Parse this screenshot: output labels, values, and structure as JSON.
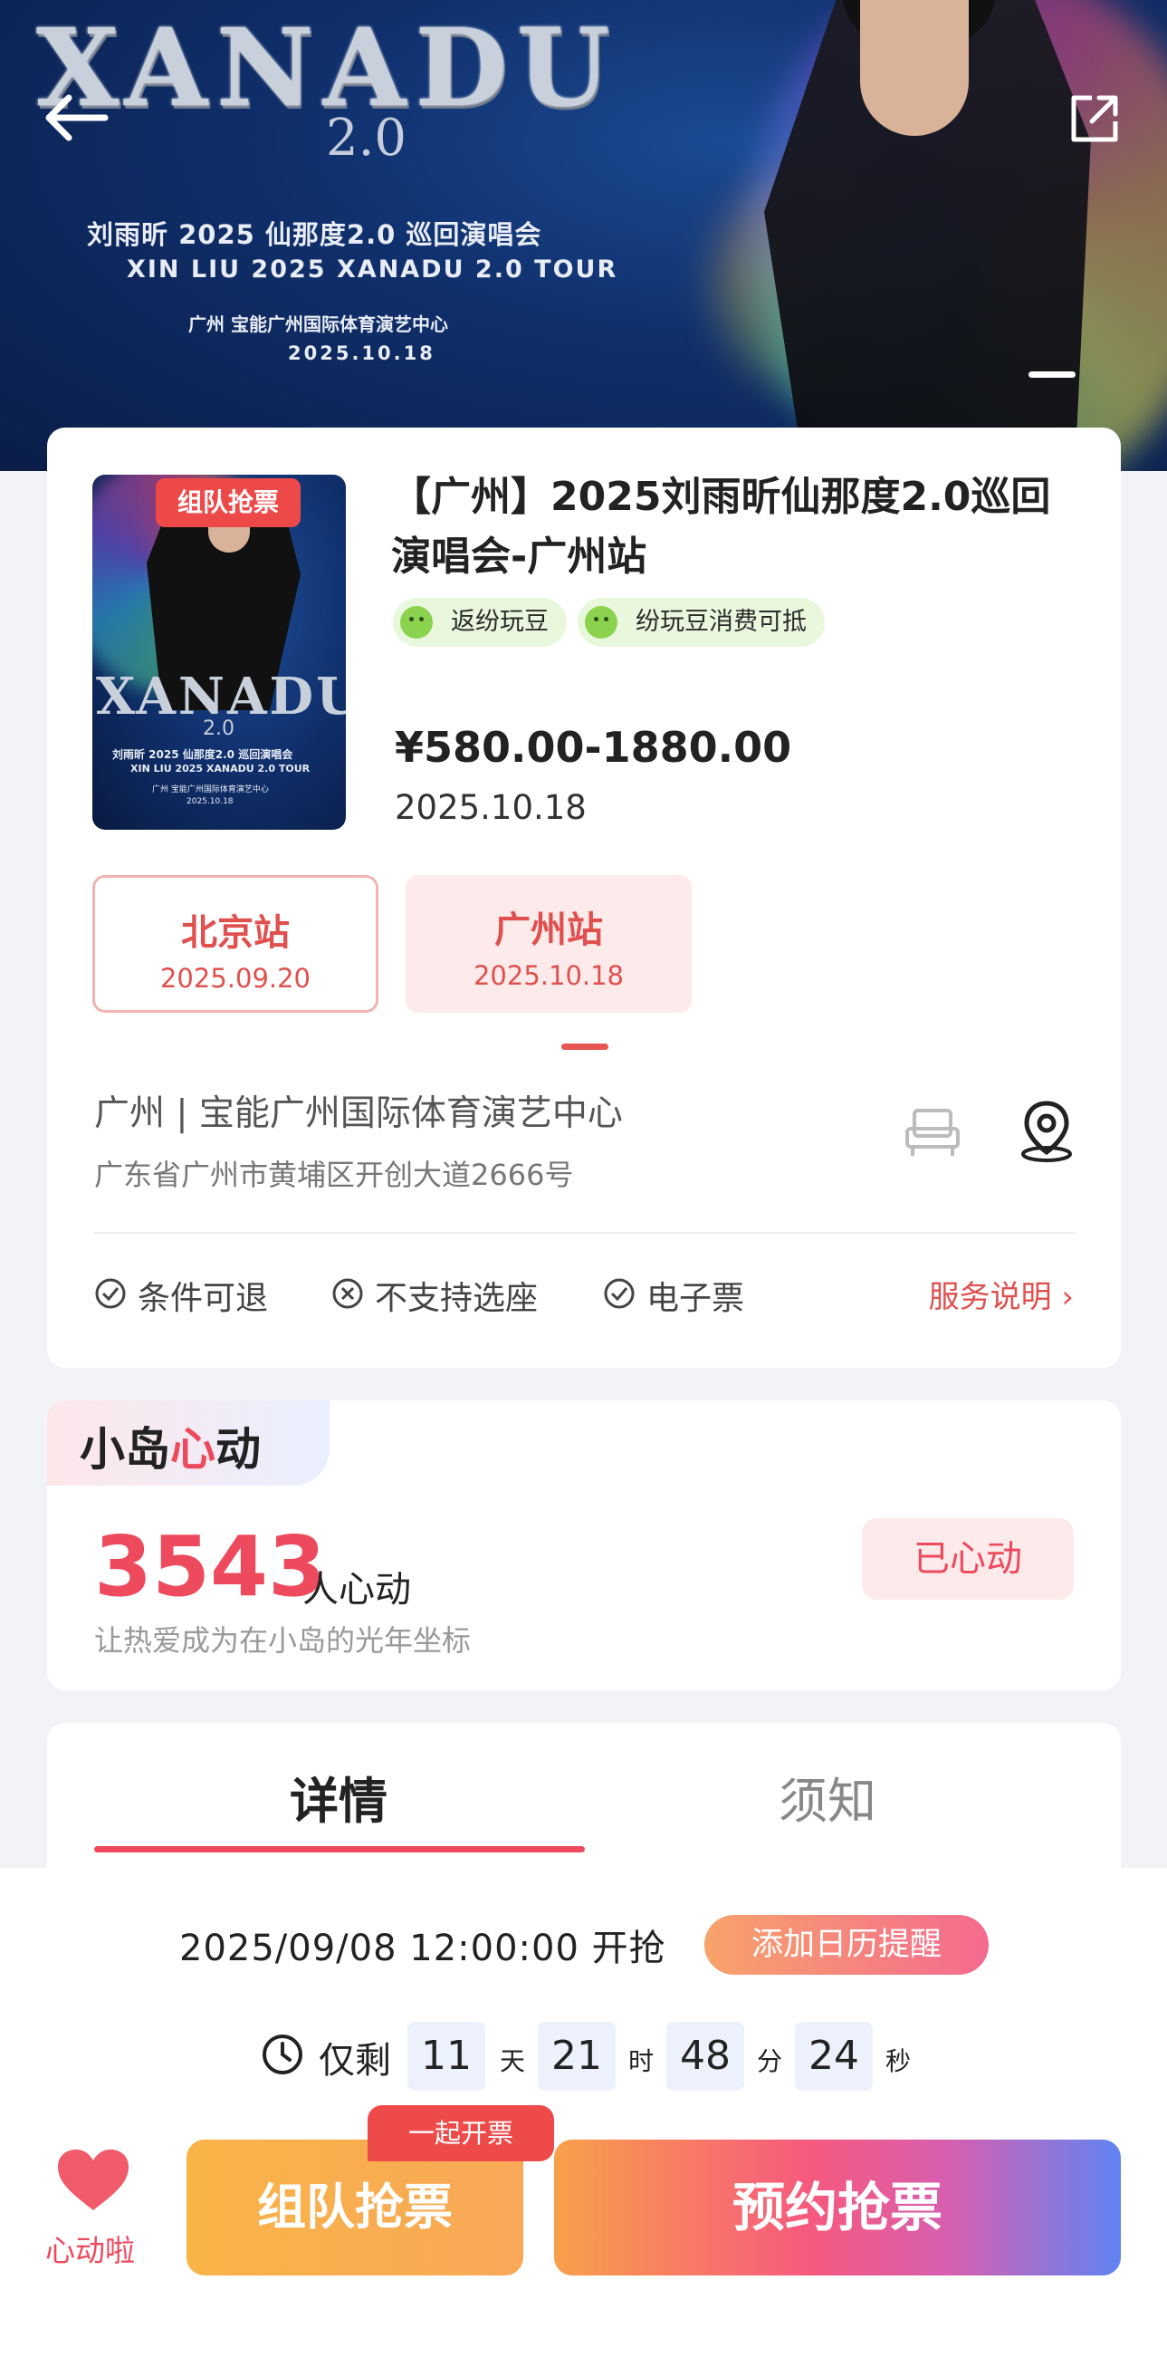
{
  "hero": {
    "logo": "XANADU",
    "logo_sub": "2.0",
    "line1": "刘雨昕 2025 仙那度2.0 巡回演唱会",
    "line2": "XIN LIU  2025  XANADU 2.0  TOUR",
    "line3": "广州  宝能广州国际体育演艺中心",
    "line4": "2025.10.18",
    "back_icon": "arrow-left-icon",
    "share_icon": "share-external-icon"
  },
  "event": {
    "badge": "组队抢票",
    "poster_logo": "XANADU",
    "poster_sub": "2.0",
    "poster_l1": "刘雨昕 2025 仙那度2.0 巡回演唱会",
    "poster_l2": "XIN LIU  2025  XANADU 2.0  TOUR",
    "poster_l3": "广州  宝能广州国际体育演艺中心",
    "poster_l4": "2025.10.18",
    "title": "【广州】2025刘雨昕仙那度2.0巡回演唱会-广州站",
    "perks": [
      "返纷玩豆",
      "纷玩豆消费可抵"
    ],
    "price": "¥580.00-1880.00",
    "date": "2025.10.18"
  },
  "stations": [
    {
      "name": "北京站",
      "date": "2025.09.20"
    },
    {
      "name": "广州站",
      "date": "2025.10.18"
    }
  ],
  "venue": {
    "name": "广州 | 宝能广州国际体育演艺中心",
    "address": "广东省广州市黄埔区开创大道2666号"
  },
  "features": [
    "条件可退",
    "不支持选座",
    "电子票"
  ],
  "service_link": "服务说明 ›",
  "island": {
    "tag_prefix": "小岛",
    "tag_heart": "心",
    "tag_suffix": "动",
    "count": "3543",
    "count_unit": "人心动",
    "slogan": "让热爱成为在小岛的光年坐标",
    "liked_label": "已心动"
  },
  "tabs": [
    "详情",
    "须知"
  ],
  "bottom": {
    "open_time": "2025/09/08 12:00:00 开抢",
    "calendar_btn": "添加日历提醒",
    "remain_label": "仅剩",
    "countdown": {
      "days": "11",
      "hours": "21",
      "minutes": "48",
      "seconds": "24"
    },
    "units": {
      "days": "天",
      "hours": "时",
      "minutes": "分",
      "seconds": "秒"
    },
    "heart_label": "心动啦",
    "team_bubble": "一起开票",
    "team_btn": "组队抢票",
    "reserve_btn": "预约抢票"
  },
  "colors": {
    "accent": "#ee4a5e",
    "perk_bg": "#e9f8dd",
    "station_text": "#e0504e"
  }
}
